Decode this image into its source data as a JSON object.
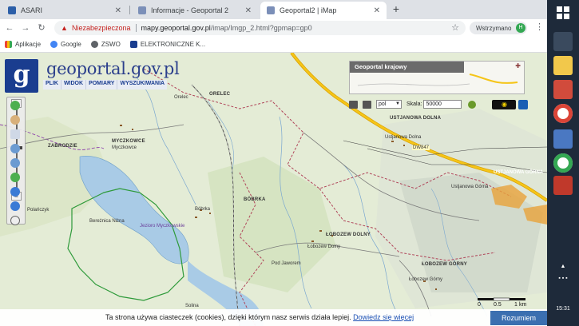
{
  "browser": {
    "tabs": [
      {
        "title": "ASARI",
        "active": false
      },
      {
        "title": "Informacje - Geoportal 2",
        "active": false
      },
      {
        "title": "Geoportal2 | iMap",
        "active": true
      }
    ],
    "new_tab": "+",
    "security_label": "Niezabezpieczona",
    "url_domain": "mapy.geoportal.gov.pl",
    "url_path": "/imap/Imgp_2.html?gpmap=gp0",
    "profile_label": "Wstrzymano",
    "avatar_letter": "H",
    "bookmarks": [
      {
        "label": "Aplikacje"
      },
      {
        "label": "Google"
      },
      {
        "label": "ZSWO"
      },
      {
        "label": "ELEKTRONICZNE K..."
      }
    ]
  },
  "map": {
    "logo_text": "geoportal.gov.pl",
    "menu": [
      "PLIK",
      "WIDOK",
      "POMIARY",
      "WYSZUKIWANIA"
    ],
    "minimap_title": "Geoportal krajowy",
    "language": "pol",
    "scale_label": "Skala:",
    "scale_value": "50000",
    "labels": {
      "orelec": "Orelec",
      "orelec_caps": "ORELEC",
      "myczkowce_caps": "MYCZKOWCE",
      "myczkowce": "Myczkowce",
      "zabrodzie": "ZABRODZIE",
      "polanczyk": "Polańczyk",
      "bereznica": "Bereżnica Niżna",
      "jezioro": "Jezioro Myczkowskie",
      "bobrka_caps": "BÓBRKA",
      "bobrka": "Bóbrka",
      "ustjanowa_dolna_caps": "USTJANOWA DOLNA",
      "ustjanowa_dolna": "Ustjanowa Dolna",
      "ustjanowa_gorna_caps": "USTJANOWA GÓRNA",
      "ustjanowa_gorna": "Ustjanowa Górna",
      "lobozew_dolny_caps": "ŁOBOZEW DOLNY",
      "lobozew_dolny": "Łobozew Dolny",
      "lobozew_gorny_caps": "ŁOBOZEW GÓRNY",
      "lobozew_gorny": "Łobozew Górny",
      "pod_jaworem": "Pod Jaworem",
      "solina": "Solina",
      "road_847": "DW847"
    },
    "scalebar": {
      "zero": "0",
      "half": "0.5",
      "one": "1",
      "unit": "km"
    },
    "cookie_text": "Ta strona używa ciasteczek (cookies), dzięki którym nasz serwis działa lepiej.",
    "cookie_link": "Dowiedz się więcej",
    "cookie_button": "Rozumiem"
  },
  "taskbar": {
    "time": "15:31"
  },
  "colors": {
    "accent": "#1a3d8f",
    "road": "#f2b705",
    "border_purple": "#8e44ad",
    "forest_green": "#2e7d32",
    "water": "#a9cbe6"
  }
}
